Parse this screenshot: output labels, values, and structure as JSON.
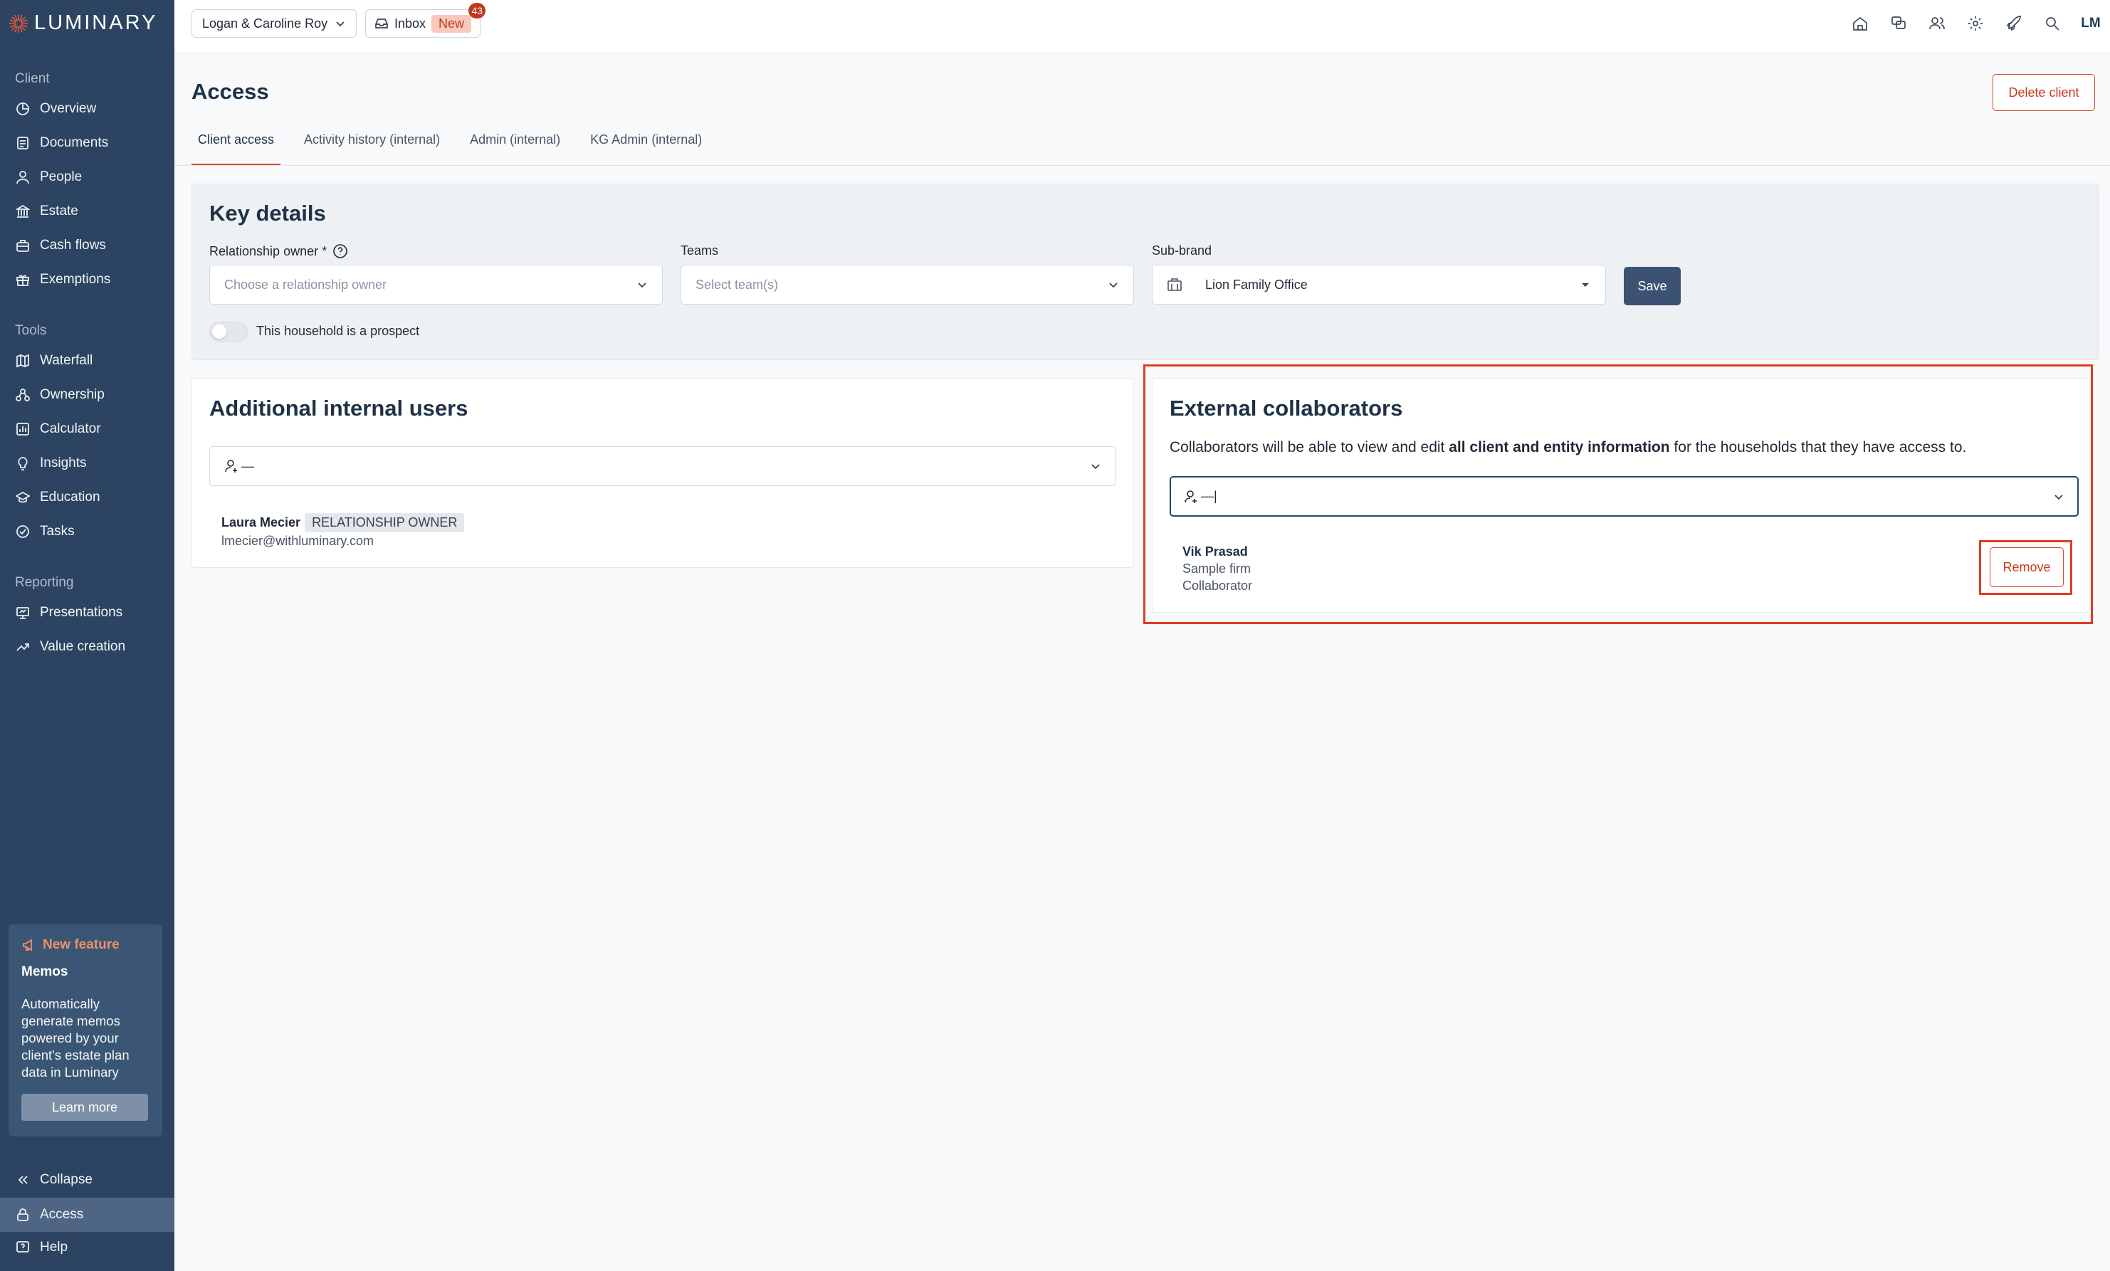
{
  "brand": {
    "name": "LUMINARY",
    "accent": "#d9452a",
    "sidebar_bg": "#2c4461"
  },
  "topbar": {
    "client_name": "Logan & Caroline Roy",
    "inbox_label": "Inbox",
    "inbox_new": "New",
    "inbox_count": "43",
    "icons": [
      "home-icon",
      "chat-icon",
      "people-icon",
      "gear-icon",
      "rocket-icon",
      "search-icon"
    ],
    "avatar_initials": "LM"
  },
  "sidebar": {
    "client_label": "Client",
    "client_items": [
      {
        "label": "Overview",
        "icon": "chart-pie-icon"
      },
      {
        "label": "Documents",
        "icon": "document-icon"
      },
      {
        "label": "People",
        "icon": "person-icon"
      },
      {
        "label": "Estate",
        "icon": "bank-icon"
      },
      {
        "label": "Cash flows",
        "icon": "briefcase-icon"
      },
      {
        "label": "Exemptions",
        "icon": "gift-icon"
      }
    ],
    "tools_label": "Tools",
    "tools_items": [
      {
        "label": "Waterfall",
        "icon": "map-icon"
      },
      {
        "label": "Ownership",
        "icon": "ownership-icon"
      },
      {
        "label": "Calculator",
        "icon": "bar-chart-icon"
      },
      {
        "label": "Insights",
        "icon": "bulb-icon"
      },
      {
        "label": "Education",
        "icon": "graduation-icon"
      },
      {
        "label": "Tasks",
        "icon": "check-circle-icon"
      }
    ],
    "reporting_label": "Reporting",
    "reporting_items": [
      {
        "label": "Presentations",
        "icon": "presentation-icon"
      },
      {
        "label": "Value creation",
        "icon": "trend-up-icon"
      }
    ],
    "promo": {
      "badge": "New feature",
      "title": "Memos",
      "text": "Automatically generate memos powered by your client's estate plan data in Luminary",
      "button": "Learn more"
    },
    "bottom_items": [
      {
        "label": "Collapse",
        "icon": "chevrons-left-icon"
      },
      {
        "label": "Access",
        "icon": "lock-icon"
      },
      {
        "label": "Help",
        "icon": "help-icon"
      }
    ]
  },
  "page": {
    "title": "Access",
    "delete_label": "Delete client",
    "tabs": [
      "Client access",
      "Activity history (internal)",
      "Admin (internal)",
      "KG Admin (internal)"
    ]
  },
  "key_details": {
    "title": "Key details",
    "owner_label": "Relationship owner *",
    "owner_placeholder": "Choose a relationship owner",
    "teams_label": "Teams",
    "teams_placeholder": "Select team(s)",
    "subbrand_label": "Sub-brand",
    "subbrand_value": "Lion Family Office",
    "save_label": "Save",
    "prospect_label": "This household is a prospect"
  },
  "internal_users": {
    "title": "Additional internal users",
    "input_value": "—",
    "user": {
      "name": "Laura Mecier",
      "badge": "RELATIONSHIP OWNER",
      "email": "lmecier@withluminary.com"
    }
  },
  "external": {
    "title": "External collaborators",
    "desc_1": "Collaborators will be able to view and edit ",
    "desc_bold": "all client and entity information",
    "desc_2": " for the households that they have access to.",
    "input_value": "—|",
    "collaborator": {
      "name": "Vik Prasad",
      "firm": "Sample firm",
      "role": "Collaborator"
    },
    "remove_label": "Remove"
  }
}
